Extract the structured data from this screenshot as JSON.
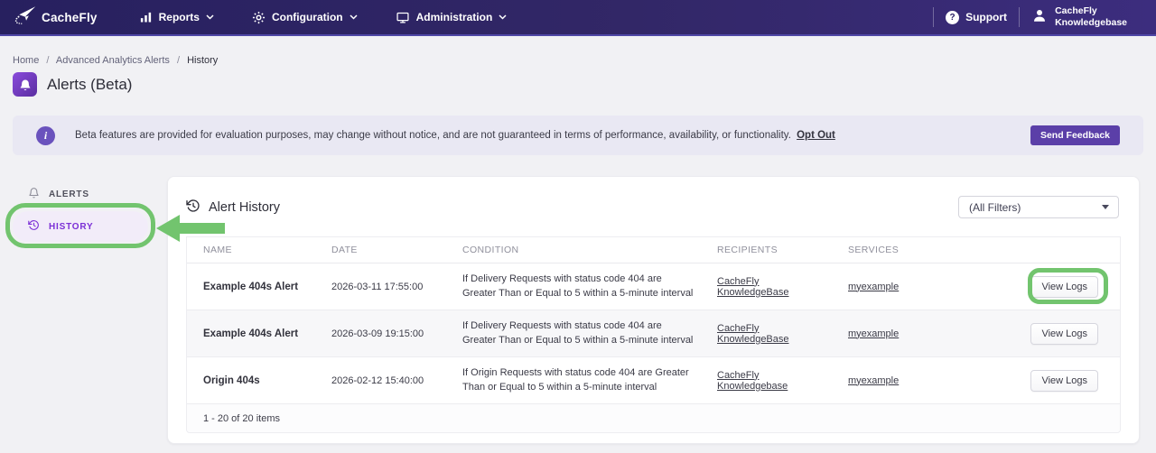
{
  "colors": {
    "nav_gradient_start": "#27205f",
    "nav_gradient_end": "#3c2d7e",
    "accent_purple": "#5b3fa8",
    "sidebar_active_purple": "#7b2fd6",
    "annotation_green": "#72c46e",
    "banner_bg": "#e9e8f3",
    "row_alt_bg": "#f7f7f9"
  },
  "nav": {
    "brand": "CacheFly",
    "items": [
      {
        "label": "Reports",
        "icon": "bar-chart-icon"
      },
      {
        "label": "Configuration",
        "icon": "gear-icon"
      },
      {
        "label": "Administration",
        "icon": "monitor-icon"
      }
    ],
    "support_label": "Support",
    "account_line1": "CacheFly",
    "account_line2": "Knowledgebase"
  },
  "breadcrumb": {
    "separator": "/",
    "items": [
      "Home",
      "Advanced Analytics Alerts",
      "History"
    ]
  },
  "page": {
    "title": "Alerts (Beta)"
  },
  "banner": {
    "text": "Beta features are provided for evaluation purposes, may change without notice, and are not guaranteed in terms of performance, availability, or functionality.",
    "link_label": "Opt Out",
    "button_label": "Send Feedback"
  },
  "sidebar": {
    "items": [
      {
        "label": "ALERTS",
        "icon": "bell-icon"
      },
      {
        "label": "HISTORY",
        "icon": "history-icon"
      }
    ]
  },
  "card": {
    "title": "Alert History",
    "filter_value": "(All Filters)",
    "table": {
      "columns": [
        "NAME",
        "DATE",
        "CONDITION",
        "RECIPIENTS",
        "SERVICES"
      ],
      "rows": [
        {
          "name": "Example 404s Alert",
          "date": "2026-03-11 17:55:00",
          "condition": "If Delivery Requests with status code 404 are Greater Than or Equal to 5 within a 5-minute interval",
          "recipients": "CacheFly KnowledgeBase",
          "services": "myexample",
          "action": "View Logs"
        },
        {
          "name": "Example 404s Alert",
          "date": "2026-03-09 19:15:00",
          "condition": "If Delivery Requests with status code 404 are Greater Than or Equal to 5 within a 5-minute interval",
          "recipients": "CacheFly KnowledgeBase",
          "services": "myexample",
          "action": "View Logs"
        },
        {
          "name": "Origin 404s",
          "date": "2026-02-12 15:40:00",
          "condition": "If Origin Requests with status code 404 are Greater Than or Equal to 5 within a 5-minute interval",
          "recipients": "CacheFly Knowledgebase",
          "services": "myexample",
          "action": "View Logs"
        }
      ],
      "footer": "1 - 20 of 20 items"
    }
  }
}
